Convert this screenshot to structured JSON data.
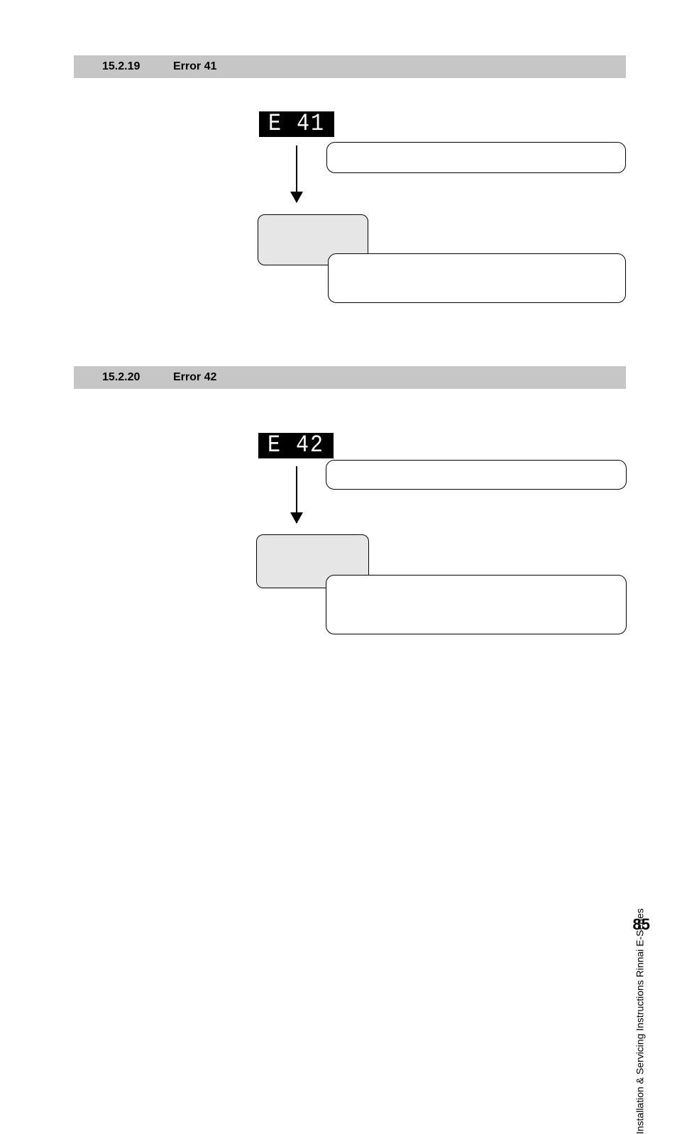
{
  "section1": {
    "num": "15.2.19",
    "title": "Error 41",
    "display": "E  41"
  },
  "section2": {
    "num": "15.2.20",
    "title": "Error 42",
    "display": "E  42"
  },
  "footer": {
    "side": "Installation & Servicing Instructions Rinnai E-Series",
    "page": "85"
  }
}
